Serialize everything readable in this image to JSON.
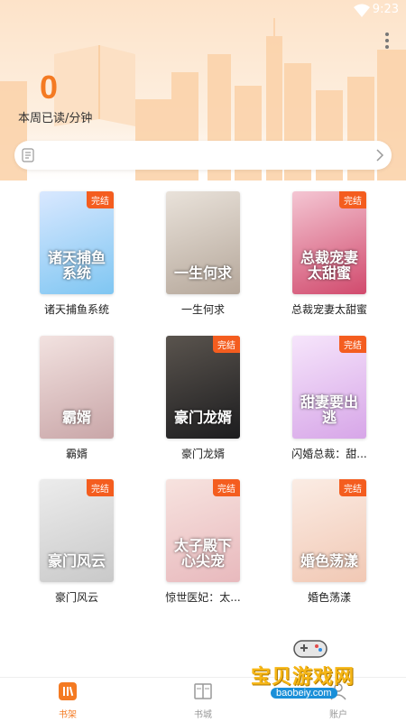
{
  "status_bar": {
    "time": "9:23"
  },
  "reading": {
    "count": "0",
    "label": "本周已读/分钟"
  },
  "search": {
    "placeholder": ""
  },
  "badge_text": "完结",
  "books": [
    {
      "title": "诸天捕鱼系统",
      "cover_text": "诸天捕鱼系统",
      "finished": true,
      "colors": [
        "#7fc6f2",
        "#d9e8ff"
      ]
    },
    {
      "title": "一生何求",
      "cover_text": "一生何求",
      "finished": false,
      "colors": [
        "#b5a79a",
        "#e9e2da"
      ]
    },
    {
      "title": "总裁宠妻太甜蜜",
      "cover_text": "总裁宠妻太甜蜜",
      "finished": true,
      "colors": [
        "#d14a6d",
        "#f4c6d3"
      ]
    },
    {
      "title": "霸婿",
      "cover_text": "霸婿",
      "finished": false,
      "colors": [
        "#c9a6a8",
        "#f2e2e0"
      ]
    },
    {
      "title": "豪门龙婿",
      "cover_text": "豪门龙婿",
      "finished": true,
      "colors": [
        "#1d1d1f",
        "#5a544e"
      ]
    },
    {
      "title": "闪婚总裁：甜...",
      "cover_text": "甜妻要出逃",
      "finished": true,
      "colors": [
        "#d7a6e8",
        "#f6e5fb"
      ]
    },
    {
      "title": "豪门风云",
      "cover_text": "豪门风云",
      "finished": true,
      "colors": [
        "#c9c9c9",
        "#ececec"
      ]
    },
    {
      "title": "惊世医妃：太...",
      "cover_text": "太子殿下心尖宠",
      "finished": true,
      "colors": [
        "#e8b9bd",
        "#f7e3df"
      ]
    },
    {
      "title": "婚色荡漾",
      "cover_text": "婚色荡漾",
      "finished": true,
      "colors": [
        "#f1c8b4",
        "#fbece4"
      ]
    }
  ],
  "bottom_nav": [
    {
      "label": "书架",
      "active": true
    },
    {
      "label": "书城",
      "active": false
    },
    {
      "label": "账户",
      "active": false
    }
  ],
  "watermark": {
    "text": "宝贝游戏网",
    "url": "baobeiy.com"
  },
  "colors": {
    "accent": "#f47a22",
    "badge": "#f45d1f"
  }
}
